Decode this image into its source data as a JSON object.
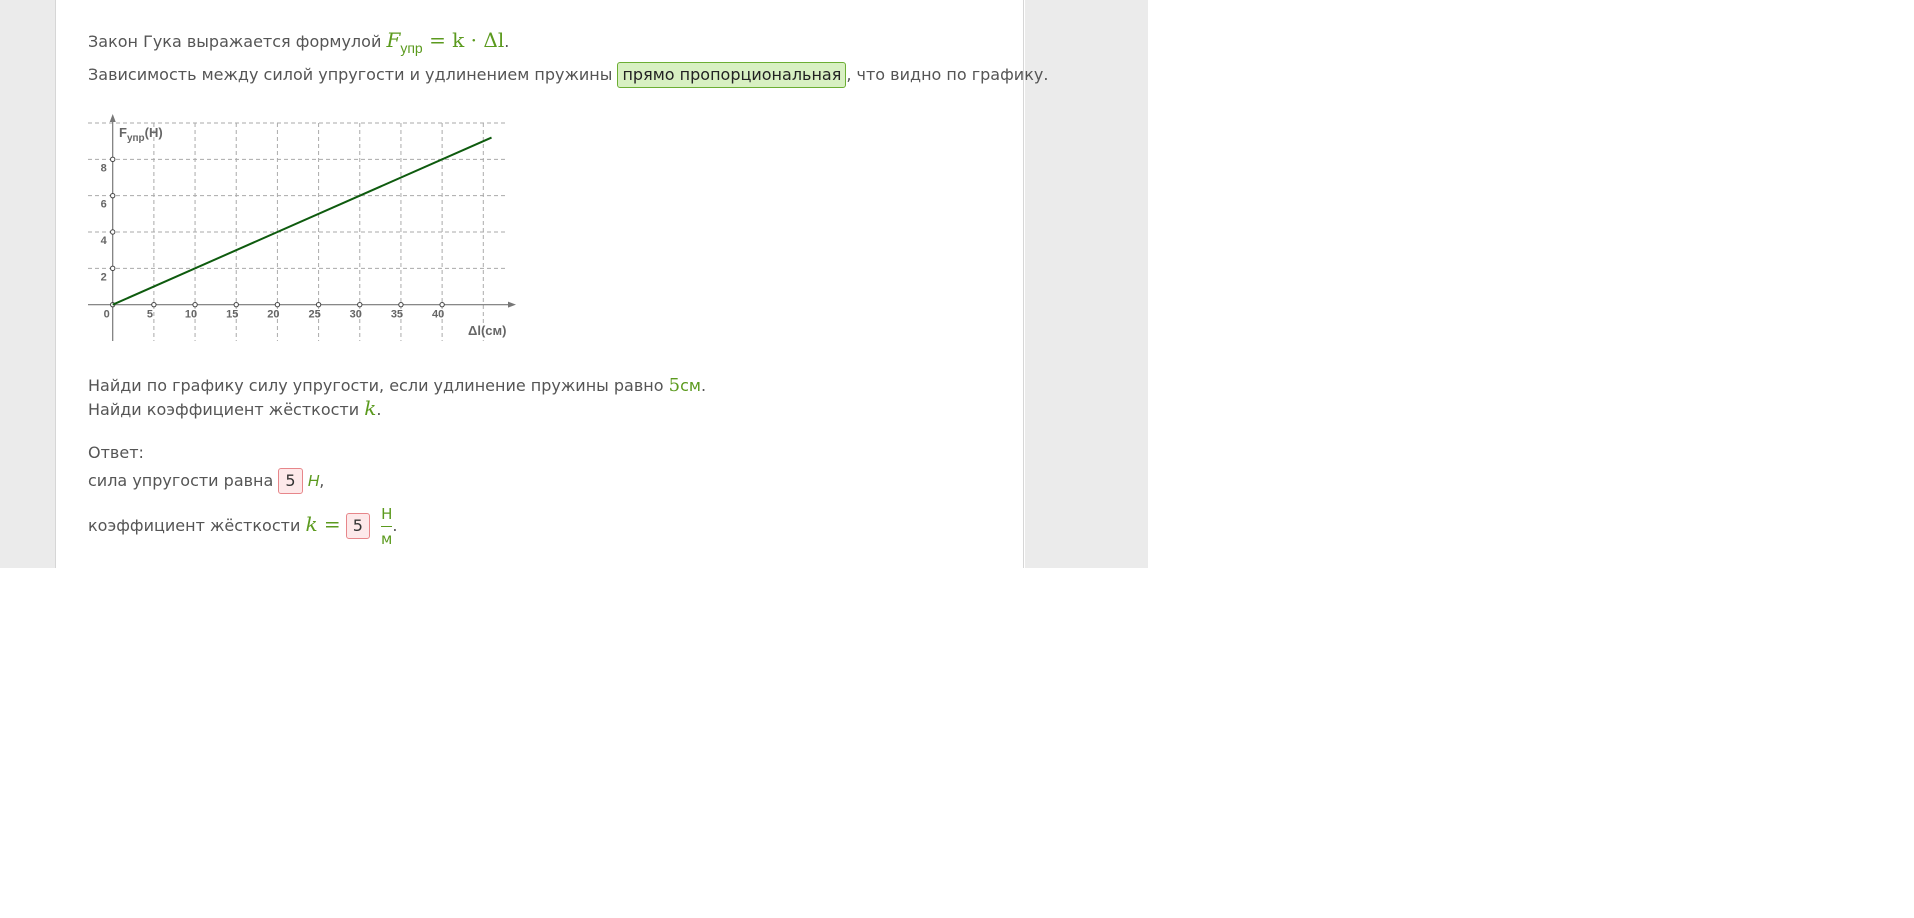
{
  "intro": {
    "line1_text": "Закон Гука выражается формулой",
    "formula_F": "F",
    "formula_sub": "упр",
    "formula_rest": "= k · Δl",
    "line1_end": ".",
    "line2_text": "Зависимость между силой упругости и удлинением пружины",
    "line2_answer": "прямо пропорциональная",
    "line2_end": ", что видно по графику."
  },
  "chart_data": {
    "type": "line",
    "y_label_main": "F",
    "y_label_sub": "упр",
    "y_label_unit": "(Н)",
    "x_label": "Δl(см)",
    "x_ticks": [
      "0",
      "5",
      "10",
      "15",
      "20",
      "25",
      "30",
      "35",
      "40"
    ],
    "x_tick_values": [
      0,
      5,
      10,
      15,
      20,
      25,
      30,
      35,
      40
    ],
    "y_ticks": [
      "2",
      "4",
      "6",
      "8"
    ],
    "y_tick_values": [
      2,
      4,
      6,
      8
    ],
    "xlim": [
      -3,
      48
    ],
    "ylim": [
      -2,
      10
    ],
    "series": [
      {
        "x": [
          0,
          46
        ],
        "y": [
          0,
          9.2
        ],
        "color": "#0e5b0e"
      }
    ],
    "grid": true
  },
  "task": {
    "q1_text": "Найди по графику силу упругости, если удлинение пружины равно",
    "q1_value": "5",
    "q1_unit": "см",
    "q1_end": ".",
    "q2_text": "Найди коэффициент жёсткости",
    "q2_var": "k",
    "q2_end": "."
  },
  "answer": {
    "title": "Ответ:",
    "force_label": "сила упругости равна",
    "force_value": "5",
    "force_unit": "Н",
    "force_end": ",",
    "k_label": "коэффициент жёсткости",
    "k_var": "k =",
    "k_value": "5",
    "k_unit_num": "Н",
    "k_unit_den": "м",
    "k_end": "."
  },
  "colors": {
    "accent_green": "#5b9a1e",
    "correct_bg": "#d8f0c2",
    "wrong_bg": "#fde9ea",
    "wrong_border": "#e7868a"
  }
}
